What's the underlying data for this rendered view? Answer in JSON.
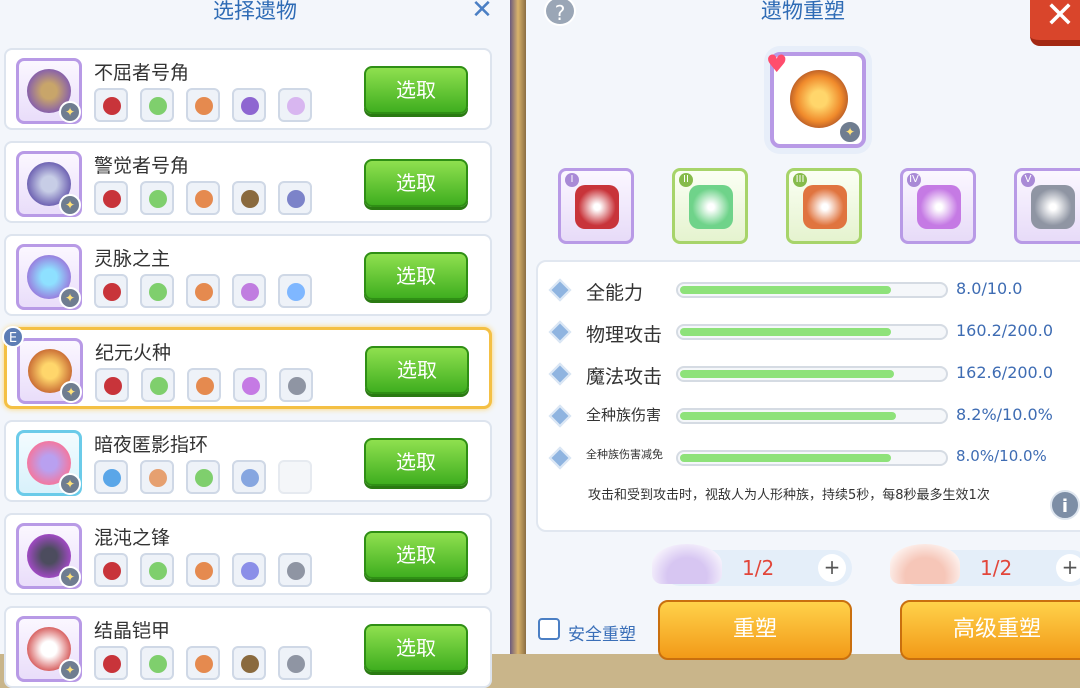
{
  "left": {
    "title": "选择遗物",
    "close": "✕",
    "pick_label": "选取",
    "epic_badge": "E",
    "relics": [
      {
        "name": "不屈者号角",
        "frame": "purple",
        "art": [
          "#c8a56a",
          "#7a52b8"
        ],
        "slots": [
          "#c8343a",
          "#7fcf6d",
          "#e58a4f",
          "#8e66d1",
          "#d8b6f0"
        ]
      },
      {
        "name": "警觉者号角",
        "frame": "purple",
        "art": [
          "#c7cde6",
          "#5c4da8"
        ],
        "slots": [
          "#c8343a",
          "#7fcf6d",
          "#e58a4f",
          "#8a6a3e",
          "#7c83c9"
        ]
      },
      {
        "name": "灵脉之主",
        "frame": "purple",
        "art": [
          "#8ee0ff",
          "#9a6bd8"
        ],
        "slots": [
          "#c8343a",
          "#7fcf6d",
          "#e58a4f",
          "#c07de0",
          "#7fb7ff"
        ]
      },
      {
        "name": "纪元火种",
        "frame": "purple",
        "art": [
          "#ffd66b",
          "#c05a2b"
        ],
        "slots": [
          "#c8343a",
          "#7fcf6d",
          "#e58a4f",
          "#c57ae4",
          "#8f95a3"
        ],
        "selected": true
      },
      {
        "name": "暗夜匿影指环",
        "frame": "blue",
        "art": [
          "#b9a0f0",
          "#ff6f8f"
        ],
        "slots": [
          "#5aa6e8",
          "#e6a070",
          "#7fcf6d",
          "#86a6e0",
          ""
        ]
      },
      {
        "name": "混沌之锋",
        "frame": "purple",
        "art": [
          "#4c4c5e",
          "#b14ad8"
        ],
        "slots": [
          "#c8343a",
          "#7fcf6d",
          "#e58a4f",
          "#8b8fe8",
          "#8f95a3"
        ]
      },
      {
        "name": "结晶铠甲",
        "frame": "purple",
        "art": [
          "#ffffff",
          "#d04343"
        ],
        "slots": [
          "#c8343a",
          "#7fcf6d",
          "#e58a4f",
          "#8a6a3e",
          "#8f95a3"
        ]
      }
    ]
  },
  "right": {
    "help": "?",
    "title": "遗物重塑",
    "close": "✕",
    "gem_slots": [
      {
        "roman": "I",
        "color": "#c8343a",
        "frame": "purple"
      },
      {
        "roman": "II",
        "color": "#6fd38a",
        "frame": "green"
      },
      {
        "roman": "III",
        "color": "#e0743f",
        "frame": "green"
      },
      {
        "roman": "IV",
        "color": "#c57ae4",
        "frame": "purple"
      },
      {
        "roman": "V",
        "color": "#8f95a3",
        "frame": "purple"
      }
    ],
    "stats": [
      {
        "label": "全能力",
        "value": "8.0/10.0",
        "fill": 0.8,
        "size": 19
      },
      {
        "label": "物理攻击",
        "value": "160.2/200.0",
        "fill": 0.8,
        "size": 19
      },
      {
        "label": "魔法攻击",
        "value": "162.6/200.0",
        "fill": 0.81,
        "size": 19
      },
      {
        "label": "全种族伤害",
        "value": "8.2%/10.0%",
        "fill": 0.82,
        "size": 15
      },
      {
        "label": "全种族伤害减免",
        "value": "8.0%/10.0%",
        "fill": 0.8,
        "size": 11
      }
    ],
    "effect": "攻击和受到攻击时，视敌人为人形种族，持续5秒，每8秒最多生效1次",
    "info": "i",
    "materials": [
      {
        "count": "1/2",
        "color": "#d7c6f2"
      },
      {
        "count": "1/2",
        "color": "#f6c6b8"
      }
    ],
    "plus": "+",
    "safe_label": "安全重塑",
    "reshape_label": "重塑",
    "adv_reshape_label": "高级重塑"
  }
}
